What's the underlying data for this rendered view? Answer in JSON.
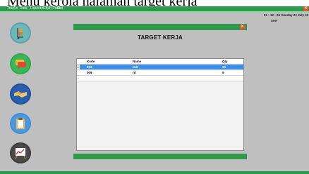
{
  "caption": "Menu kerola halaman target kerja",
  "menu": [
    {
      "label": "Tranks"
    },
    {
      "label": "Data"
    },
    {
      "label": "Laporan"
    },
    {
      "label": "Ubah Pass"
    },
    {
      "label": "Out"
    }
  ],
  "status": {
    "clock": "01 : 12 : 05  Sunday 23 July 20",
    "user": "user"
  },
  "sidebar": [
    {
      "icon": "user-dolly-icon"
    },
    {
      "icon": "chat-bubble-icon"
    },
    {
      "icon": "handshake-icon"
    },
    {
      "icon": "clipboard-icon"
    },
    {
      "icon": "chart-board-icon"
    }
  ],
  "panel": {
    "title": "TARGET KERJA",
    "close_glyph": "×"
  },
  "grid": {
    "columns": [
      "Kode",
      "Name",
      "Qty"
    ],
    "rows": [
      {
        "marker": "▸",
        "kode": "002",
        "name": "test",
        "qty": "20",
        "selected": true
      },
      {
        "marker": "",
        "kode": "009",
        "name": "rd",
        "qty": "5",
        "selected": false
      },
      {
        "marker": "*",
        "kode": "",
        "name": "",
        "qty": "",
        "selected": false
      }
    ]
  },
  "colors": {
    "accent_green": "#2e9a4c",
    "selection_blue": "#3b8fe6",
    "close_red": "#e35a37"
  }
}
